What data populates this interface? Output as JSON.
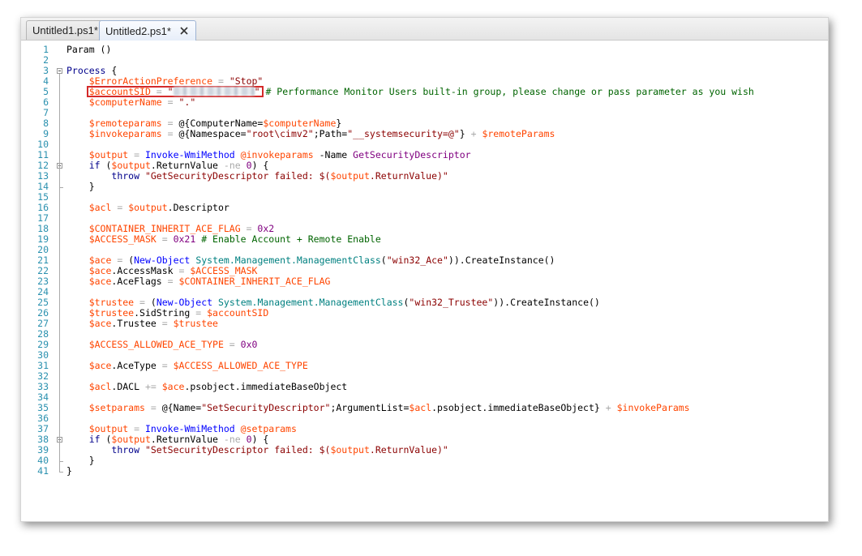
{
  "tabs": [
    {
      "label": "Untitled1.ps1*",
      "active": false
    },
    {
      "label": "Untitled2.ps1*",
      "active": true,
      "close_icon": "close-icon"
    }
  ],
  "colors": {
    "variable": "#ff4500",
    "string": "#8b0000",
    "keyword": "#00008b",
    "comment": "#006400",
    "operator": "#a9a9a9",
    "number": "#800080",
    "command": "#0000ff",
    "type": "#008080",
    "line_number": "#2b91af",
    "highlight_box": "#d42a2a"
  },
  "code_lines": [
    {
      "n": "1",
      "t": [
        [
          "p",
          "Param ()"
        ]
      ]
    },
    {
      "n": "2",
      "t": []
    },
    {
      "n": "3",
      "t": [
        [
          "k",
          "Process"
        ],
        [
          "p",
          " {"
        ]
      ]
    },
    {
      "n": "4",
      "t": [
        [
          "p",
          "    "
        ],
        [
          "v",
          "$ErrorActionPreference"
        ],
        [
          "o",
          " = "
        ],
        [
          "s",
          "\"Stop\""
        ]
      ]
    },
    {
      "n": "5",
      "t": [
        [
          "p",
          "    "
        ],
        [
          "v",
          "$accountSID"
        ],
        [
          "o",
          " = "
        ],
        [
          "s",
          "\""
        ],
        [
          "r",
          ""
        ],
        [
          "s",
          "\""
        ],
        [
          "c",
          " # Performance Monitor Users built-in group, please change or pass parameter as you wish"
        ]
      ]
    },
    {
      "n": "6",
      "t": [
        [
          "p",
          "    "
        ],
        [
          "v",
          "$computerName"
        ],
        [
          "o",
          " = "
        ],
        [
          "s",
          "\".\""
        ]
      ]
    },
    {
      "n": "7",
      "t": []
    },
    {
      "n": "8",
      "t": [
        [
          "p",
          "    "
        ],
        [
          "v",
          "$remoteparams"
        ],
        [
          "o",
          " = "
        ],
        [
          "p",
          "@{ComputerName="
        ],
        [
          "v",
          "$computerName"
        ],
        [
          "p",
          "}"
        ]
      ]
    },
    {
      "n": "9",
      "t": [
        [
          "p",
          "    "
        ],
        [
          "v",
          "$invokeparams"
        ],
        [
          "o",
          " = "
        ],
        [
          "p",
          "@{Namespace="
        ],
        [
          "s",
          "\"root\\cimv2\""
        ],
        [
          "p",
          ";Path="
        ],
        [
          "s",
          "\"__systemsecurity=@\""
        ],
        [
          "p",
          "}"
        ],
        [
          "o",
          " + "
        ],
        [
          "v",
          "$remoteParams"
        ]
      ]
    },
    {
      "n": "10",
      "t": []
    },
    {
      "n": "11",
      "t": [
        [
          "p",
          "    "
        ],
        [
          "v",
          "$output"
        ],
        [
          "o",
          " = "
        ],
        [
          "cm",
          "Invoke-WmiMethod"
        ],
        [
          "p",
          " "
        ],
        [
          "v",
          "@invokeparams"
        ],
        [
          "p",
          " -Name "
        ],
        [
          "n",
          "GetSecurityDescriptor"
        ]
      ]
    },
    {
      "n": "12",
      "t": [
        [
          "p",
          "    "
        ],
        [
          "k",
          "if"
        ],
        [
          "p",
          " ("
        ],
        [
          "v",
          "$output"
        ],
        [
          "p",
          ".ReturnValue "
        ],
        [
          "o",
          "-ne"
        ],
        [
          "p",
          " "
        ],
        [
          "n",
          "0"
        ],
        [
          "p",
          ") {"
        ]
      ]
    },
    {
      "n": "13",
      "t": [
        [
          "p",
          "        "
        ],
        [
          "k",
          "throw"
        ],
        [
          "p",
          " "
        ],
        [
          "s",
          "\"GetSecurityDescriptor failed: $("
        ],
        [
          "v",
          "$output"
        ],
        [
          "s",
          ".ReturnValue)\""
        ]
      ]
    },
    {
      "n": "14",
      "t": [
        [
          "p",
          "    }"
        ]
      ]
    },
    {
      "n": "15",
      "t": []
    },
    {
      "n": "16",
      "t": [
        [
          "p",
          "    "
        ],
        [
          "v",
          "$acl"
        ],
        [
          "o",
          " = "
        ],
        [
          "v",
          "$output"
        ],
        [
          "p",
          ".Descriptor"
        ]
      ]
    },
    {
      "n": "17",
      "t": []
    },
    {
      "n": "18",
      "t": [
        [
          "p",
          "    "
        ],
        [
          "v",
          "$CONTAINER_INHERIT_ACE_FLAG"
        ],
        [
          "o",
          " = "
        ],
        [
          "n",
          "0x2"
        ]
      ]
    },
    {
      "n": "19",
      "t": [
        [
          "p",
          "    "
        ],
        [
          "v",
          "$ACCESS_MASK"
        ],
        [
          "o",
          " = "
        ],
        [
          "n",
          "0x21"
        ],
        [
          "c",
          " # Enable Account + Remote Enable"
        ]
      ]
    },
    {
      "n": "20",
      "t": []
    },
    {
      "n": "21",
      "t": [
        [
          "p",
          "    "
        ],
        [
          "v",
          "$ace"
        ],
        [
          "o",
          " = "
        ],
        [
          "p",
          "("
        ],
        [
          "cm",
          "New-Object"
        ],
        [
          "p",
          " "
        ],
        [
          "ty",
          "System.Management.ManagementClass"
        ],
        [
          "p",
          "("
        ],
        [
          "s",
          "\"win32_Ace\""
        ],
        [
          "p",
          "))."
        ],
        [
          "p",
          "CreateInstance()"
        ]
      ]
    },
    {
      "n": "22",
      "t": [
        [
          "p",
          "    "
        ],
        [
          "v",
          "$ace"
        ],
        [
          "p",
          ".AccessMask"
        ],
        [
          "o",
          " = "
        ],
        [
          "v",
          "$ACCESS_MASK"
        ]
      ]
    },
    {
      "n": "23",
      "t": [
        [
          "p",
          "    "
        ],
        [
          "v",
          "$ace"
        ],
        [
          "p",
          ".AceFlags"
        ],
        [
          "o",
          " = "
        ],
        [
          "v",
          "$CONTAINER_INHERIT_ACE_FLAG"
        ]
      ]
    },
    {
      "n": "24",
      "t": []
    },
    {
      "n": "25",
      "t": [
        [
          "p",
          "    "
        ],
        [
          "v",
          "$trustee"
        ],
        [
          "o",
          " = "
        ],
        [
          "p",
          "("
        ],
        [
          "cm",
          "New-Object"
        ],
        [
          "p",
          " "
        ],
        [
          "ty",
          "System.Management.ManagementClass"
        ],
        [
          "p",
          "("
        ],
        [
          "s",
          "\"win32_Trustee\""
        ],
        [
          "p",
          "))."
        ],
        [
          "p",
          "CreateInstance()"
        ]
      ]
    },
    {
      "n": "26",
      "t": [
        [
          "p",
          "    "
        ],
        [
          "v",
          "$trustee"
        ],
        [
          "p",
          ".SidString"
        ],
        [
          "o",
          " = "
        ],
        [
          "v",
          "$accountSID"
        ]
      ]
    },
    {
      "n": "27",
      "t": [
        [
          "p",
          "    "
        ],
        [
          "v",
          "$ace"
        ],
        [
          "p",
          ".Trustee"
        ],
        [
          "o",
          " = "
        ],
        [
          "v",
          "$trustee"
        ]
      ]
    },
    {
      "n": "28",
      "t": []
    },
    {
      "n": "29",
      "t": [
        [
          "p",
          "    "
        ],
        [
          "v",
          "$ACCESS_ALLOWED_ACE_TYPE"
        ],
        [
          "o",
          " = "
        ],
        [
          "n",
          "0x0"
        ]
      ]
    },
    {
      "n": "30",
      "t": []
    },
    {
      "n": "31",
      "t": [
        [
          "p",
          "    "
        ],
        [
          "v",
          "$ace"
        ],
        [
          "p",
          ".AceType"
        ],
        [
          "o",
          " = "
        ],
        [
          "v",
          "$ACCESS_ALLOWED_ACE_TYPE"
        ]
      ]
    },
    {
      "n": "32",
      "t": []
    },
    {
      "n": "33",
      "t": [
        [
          "p",
          "    "
        ],
        [
          "v",
          "$acl"
        ],
        [
          "p",
          ".DACL"
        ],
        [
          "o",
          " += "
        ],
        [
          "v",
          "$ace"
        ],
        [
          "p",
          ".psobject.immediateBaseObject"
        ]
      ]
    },
    {
      "n": "34",
      "t": []
    },
    {
      "n": "35",
      "t": [
        [
          "p",
          "    "
        ],
        [
          "v",
          "$setparams"
        ],
        [
          "o",
          " = "
        ],
        [
          "p",
          "@{Name="
        ],
        [
          "s",
          "\"SetSecurityDescriptor\""
        ],
        [
          "p",
          ";ArgumentList="
        ],
        [
          "v",
          "$acl"
        ],
        [
          "p",
          ".psobject.immediateBaseObject}"
        ],
        [
          "o",
          " + "
        ],
        [
          "v",
          "$invokeParams"
        ]
      ]
    },
    {
      "n": "36",
      "t": []
    },
    {
      "n": "37",
      "t": [
        [
          "p",
          "    "
        ],
        [
          "v",
          "$output"
        ],
        [
          "o",
          " = "
        ],
        [
          "cm",
          "Invoke-WmiMethod"
        ],
        [
          "p",
          " "
        ],
        [
          "v",
          "@setparams"
        ]
      ]
    },
    {
      "n": "38",
      "t": [
        [
          "p",
          "    "
        ],
        [
          "k",
          "if"
        ],
        [
          "p",
          " ("
        ],
        [
          "v",
          "$output"
        ],
        [
          "p",
          ".ReturnValue "
        ],
        [
          "o",
          "-ne"
        ],
        [
          "p",
          " "
        ],
        [
          "n",
          "0"
        ],
        [
          "p",
          ") {"
        ]
      ]
    },
    {
      "n": "39",
      "t": [
        [
          "p",
          "        "
        ],
        [
          "k",
          "throw"
        ],
        [
          "p",
          " "
        ],
        [
          "s",
          "\"SetSecurityDescriptor failed: $("
        ],
        [
          "v",
          "$output"
        ],
        [
          "s",
          ".ReturnValue)\""
        ]
      ]
    },
    {
      "n": "40",
      "t": [
        [
          "p",
          "    }"
        ]
      ]
    },
    {
      "n": "41",
      "t": [
        [
          "p",
          "}"
        ]
      ]
    }
  ]
}
